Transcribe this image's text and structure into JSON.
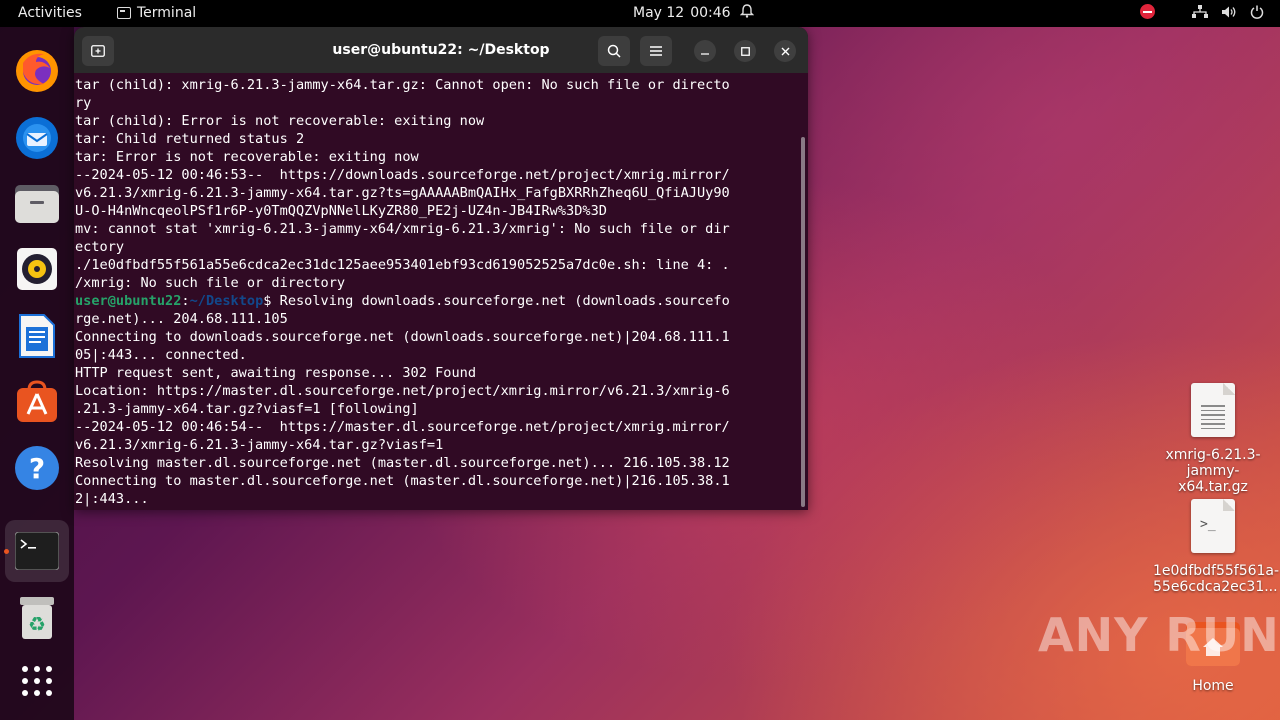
{
  "topbar": {
    "activities": "Activities",
    "app_name": "Terminal",
    "date": "May 12",
    "time": "00:46"
  },
  "dock": {
    "items": [
      {
        "name": "firefox"
      },
      {
        "name": "thunderbird"
      },
      {
        "name": "files"
      },
      {
        "name": "rhythmbox"
      },
      {
        "name": "libreoffice-writer"
      },
      {
        "name": "app-center"
      },
      {
        "name": "help"
      },
      {
        "name": "terminal"
      },
      {
        "name": "trash"
      },
      {
        "name": "show-apps"
      }
    ]
  },
  "terminal": {
    "title": "user@ubuntu22: ~/Desktop",
    "prompt_user": "user@ubuntu22",
    "prompt_sep": ":",
    "prompt_path": "~/Desktop",
    "lines_before": [
      "tar (child): xmrig-6.21.3-jammy-x64.tar.gz: Cannot open: No such file or directo",
      "ry",
      "tar (child): Error is not recoverable: exiting now",
      "tar: Child returned status 2",
      "tar: Error is not recoverable: exiting now",
      "--2024-05-12 00:46:53--  https://downloads.sourceforge.net/project/xmrig.mirror/",
      "v6.21.3/xmrig-6.21.3-jammy-x64.tar.gz?ts=gAAAAABmQAIHx_FafgBXRRhZheq6U_QfiAJUy90",
      "U-O-H4nWncqeolPSf1r6P-y0TmQQZVpNNelLKyZR80_PE2j-UZ4n-JB4IRw%3D%3D",
      "mv: cannot stat 'xmrig-6.21.3-jammy-x64/xmrig-6.21.3/xmrig': No such file or dir",
      "ectory",
      "./1e0dfbdf55f561a55e6cdca2ec31dc125aee953401ebf93cd619052525a7dc0e.sh: line 4: .",
      "/xmrig: No such file or directory"
    ],
    "prompt_tail": "$ Resolving downloads.sourceforge.net (downloads.sourcefo",
    "lines_after": [
      "rge.net)... 204.68.111.105",
      "Connecting to downloads.sourceforge.net (downloads.sourceforge.net)|204.68.111.1",
      "05|:443... connected.",
      "HTTP request sent, awaiting response... 302 Found",
      "Location: https://master.dl.sourceforge.net/project/xmrig.mirror/v6.21.3/xmrig-6",
      ".21.3-jammy-x64.tar.gz?viasf=1 [following]",
      "--2024-05-12 00:46:54--  https://master.dl.sourceforge.net/project/xmrig.mirror/",
      "v6.21.3/xmrig-6.21.3-jammy-x64.tar.gz?viasf=1",
      "Resolving master.dl.sourceforge.net (master.dl.sourceforge.net)... 216.105.38.12",
      "Connecting to master.dl.sourceforge.net (master.dl.sourceforge.net)|216.105.38.1",
      "2|:443..."
    ]
  },
  "desktop": {
    "icons": [
      {
        "label_line1": "xmrig-6.21.3-",
        "label_line2": "jammy-x64.tar.gz"
      },
      {
        "label_line1": "1e0dfbdf55f561a-",
        "label_line2": "55e6cdca2ec31..."
      },
      {
        "label_line1": "Home",
        "label_line2": ""
      }
    ]
  },
  "watermark": "ANY RUN",
  "colors": {
    "terminal_bg": "#300a24",
    "prompt_user": "#26a269",
    "prompt_path": "#12488b",
    "accent": "#e95420"
  }
}
